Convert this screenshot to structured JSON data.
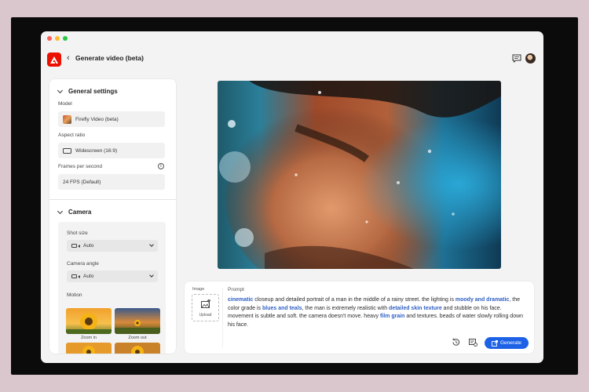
{
  "app": {
    "title": "Generate video (beta)",
    "back_glyph": "‹",
    "brand_color": "#eb1000",
    "accent": "#1d62e6"
  },
  "window_controls": [
    {
      "name": "close",
      "color": "#ff5f57"
    },
    {
      "name": "minimize",
      "color": "#febc2e"
    },
    {
      "name": "maximize",
      "color": "#28c840"
    }
  ],
  "header_icons": [
    "chat-icon",
    "avatar"
  ],
  "general_settings": {
    "heading": "General settings",
    "model_label": "Model",
    "model_value": "Firefly Video (beta)",
    "aspect_label": "Aspect ratio",
    "aspect_value": "Widescreen (16:9)",
    "fps_label": "Frames per second",
    "fps_value": "24 FPS (Default)",
    "info_glyph": "i"
  },
  "camera": {
    "heading": "Camera",
    "shot_label": "Shot size",
    "shot_value": "Auto",
    "angle_label": "Camera angle",
    "angle_value": "Auto",
    "motion_label": "Motion",
    "motions": [
      {
        "label": "Zoom in"
      },
      {
        "label": "Zoom out"
      },
      {
        "label": ""
      },
      {
        "label": ""
      }
    ]
  },
  "prompt_panel": {
    "image_label": "Image",
    "upload_label": "Upload",
    "prompt_label": "Prompt",
    "prompt_segments": [
      {
        "text": "cinematic",
        "kw": true
      },
      {
        "text": " closeup and detailed portrait of a man in the middle of a rainy street. the lighting is ",
        "kw": false
      },
      {
        "text": "moody and dramatic",
        "kw": true
      },
      {
        "text": ", the color grade is ",
        "kw": false
      },
      {
        "text": "blues and teals",
        "kw": true
      },
      {
        "text": ", the man is extremely realistic with ",
        "kw": false
      },
      {
        "text": "detailed skin texture",
        "kw": true
      },
      {
        "text": " and stubble on his face. movement is subtle and soft. the camera doesn't move. heavy ",
        "kw": false
      },
      {
        "text": "film grain",
        "kw": true
      },
      {
        "text": " and textures. beads of water slowly rolling down his face.",
        "kw": false
      }
    ],
    "generate_label": "Generate",
    "tool_icons": [
      "history-icon",
      "style-reference-icon"
    ]
  }
}
